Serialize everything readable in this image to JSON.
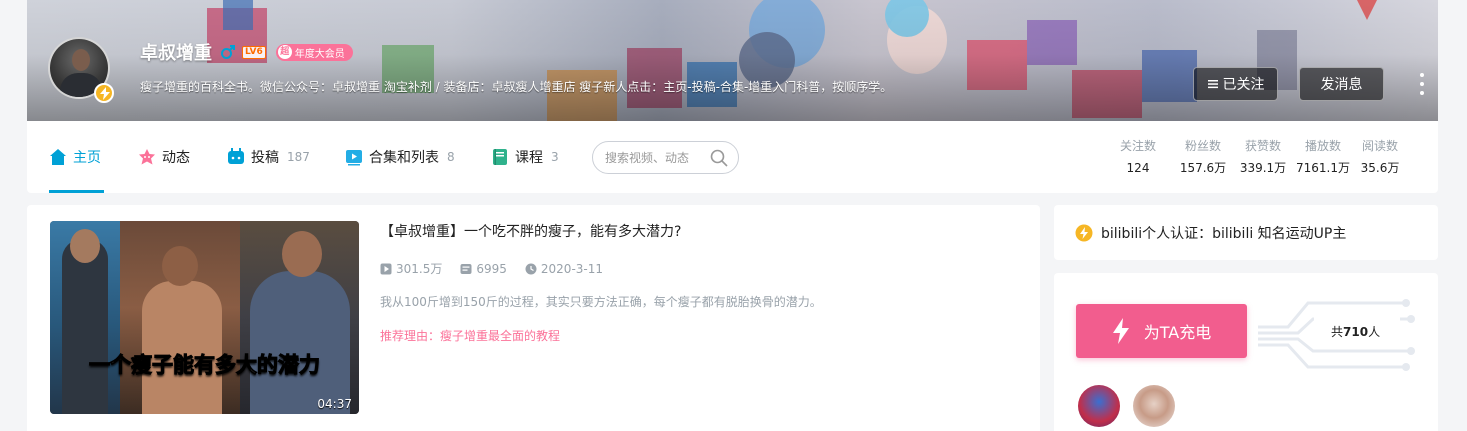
{
  "profile": {
    "name": "卓叔增重",
    "level": "LV6",
    "vip_icon": "超",
    "vip_label": "年度大会员",
    "sign": "瘦子增重的百科全书。微信公众号：卓叔增重 淘宝补剂 / 装备店：卓叔瘦人增重店 瘦子新人点击：主页-投稿-合集-增重入门科普，按顺序学。",
    "follow_label": "已关注",
    "message_label": "发消息"
  },
  "nav": {
    "home": "主页",
    "dynamic": "动态",
    "upload": "投稿",
    "upload_count": "187",
    "collections": "合集和列表",
    "collections_count": "8",
    "courses": "课程",
    "courses_count": "3",
    "search_placeholder": "搜索视频、动态"
  },
  "stats": [
    {
      "label": "关注数",
      "value": "124"
    },
    {
      "label": "粉丝数",
      "value": "157.6万"
    },
    {
      "label": "获赞数",
      "value": "339.1万"
    },
    {
      "label": "播放数",
      "value": "7161.1万"
    },
    {
      "label": "阅读数",
      "value": "35.6万"
    }
  ],
  "featured": {
    "title": "【卓叔增重】一个吃不胖的瘦子，能有多大潜力?",
    "plays": "301.5万",
    "danmaku": "6995",
    "date": "2020-3-11",
    "desc": "我从100斤增到150斤的过程，其实只要方法正确，每个瘦子都有脱胎换骨的潜力。",
    "reason": "推荐理由：瘦子增重最全面的教程",
    "cover_text_1": "一个",
    "cover_text_2": "瘦子",
    "cover_text_3": "能有多大的",
    "cover_text_4": "潜力",
    "duration": "04:37"
  },
  "side": {
    "cert": "bilibili个人认证：bilibili 知名运动UP主",
    "charge_button": "为TA充电",
    "charge_prefix": "共",
    "charge_count": "710",
    "charge_suffix": "人"
  },
  "colors": {
    "accent": "#00a1d6",
    "pink": "#fb7299",
    "charge": "#f25d8e",
    "badge": "#f6b624"
  }
}
